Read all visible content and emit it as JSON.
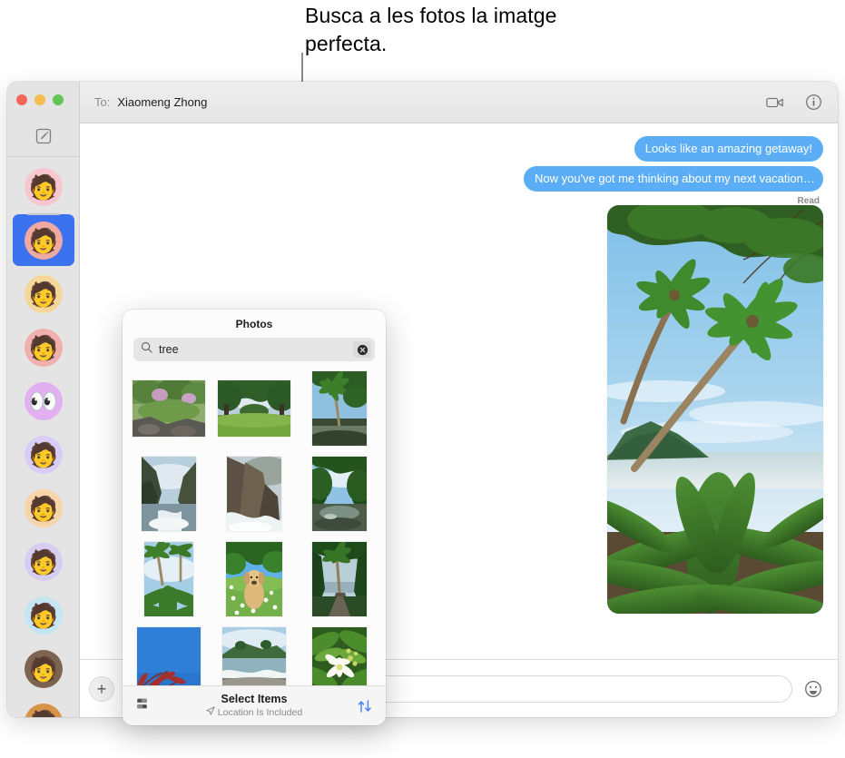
{
  "callout": {
    "text": "Busca a les fotos la imatge perfecta."
  },
  "window": {
    "titlebar": {
      "to_label": "To:",
      "recipient": "Xiaomeng Zhong",
      "facetime_icon": "video-camera-icon",
      "info_icon": "info-circle-icon"
    },
    "traffic_lights": {
      "close": "#f2655a",
      "minimize": "#f5bd4f",
      "zoom": "#61c454"
    }
  },
  "sidebar": {
    "compose_icon": "compose-new-message-icon",
    "selected_index": 1,
    "conversations": [
      {
        "name": "memoji-woman-headband",
        "bg": "#f7c7d0",
        "glyph": "👩",
        "selected": false
      },
      {
        "name": "memoji-woman-dark-hair",
        "bg": "#f0a9a0",
        "glyph": "👩",
        "selected": true
      },
      {
        "name": "memoji-person-green-cap",
        "bg": "#f6d79a",
        "glyph": "🧓",
        "selected": false
      },
      {
        "name": "memoji-woman-glasses-bun",
        "bg": "#f0b0ae",
        "glyph": "👩",
        "selected": false
      },
      {
        "name": "memoji-eyes-purple",
        "bg": "#e2aff0",
        "glyph": "👀",
        "selected": false
      },
      {
        "name": "memoji-man-yellow-glasses",
        "bg": "#d9cdf5",
        "glyph": "👨",
        "selected": false
      },
      {
        "name": "memoji-woman-grey-hair",
        "bg": "#f8d5a8",
        "glyph": "👵",
        "selected": false
      },
      {
        "name": "memoji-man-grey-hat",
        "bg": "#d5cdf2",
        "glyph": "🧔",
        "selected": false
      },
      {
        "name": "memoji-man-beard-beanie",
        "bg": "#c4e5f2",
        "glyph": "🧔",
        "selected": false
      },
      {
        "name": "photo-woman-smiling",
        "bg": "#7d6452",
        "glyph": "👩",
        "selected": false
      },
      {
        "name": "photo-person-partial",
        "bg": "#d79448",
        "glyph": "👤",
        "selected": false
      }
    ]
  },
  "thread": {
    "messages": [
      {
        "text": "Looks like an amazing getaway!",
        "side": "outgoing",
        "tail": false
      },
      {
        "text": "Now you've got me thinking about my next vacation…",
        "side": "outgoing",
        "tail": true
      }
    ],
    "read_receipt": "Read",
    "attached_photo": "tropical-beach-palm-trees-photo",
    "bubble_color": "#5baef5"
  },
  "compose": {
    "add_button_icon": "plus-icon",
    "input_value": "",
    "input_placeholder": "",
    "emoji_icon": "smiley-face-icon"
  },
  "photos_popover": {
    "title": "Photos",
    "search": {
      "icon": "magnifying-glass-icon",
      "value": "tree",
      "placeholder": "Search",
      "clear_icon": "clear-x-circle-icon"
    },
    "thumbnails": [
      {
        "name": "forest-stream-rocks-thumb",
        "orientation": "landscape"
      },
      {
        "name": "green-meadow-trees-thumb",
        "orientation": "landscape"
      },
      {
        "name": "palm-tree-river-thumb",
        "orientation": "portrait"
      },
      {
        "name": "coastal-cliffs-sea-thumb",
        "orientation": "portrait"
      },
      {
        "name": "rocky-shoreline-surf-thumb",
        "orientation": "portrait"
      },
      {
        "name": "jungle-river-reflection-thumb",
        "orientation": "portrait"
      },
      {
        "name": "palm-trees-foliage-thumb",
        "orientation": "portrait"
      },
      {
        "name": "dog-in-flower-field-thumb",
        "orientation": "portrait"
      },
      {
        "name": "palm-path-ocean-thumb",
        "orientation": "portrait"
      },
      {
        "name": "red-leaves-blue-sky-thumb",
        "orientation": "portrait"
      },
      {
        "name": "beach-shoreline-thumb",
        "orientation": "portrait"
      },
      {
        "name": "white-flower-leaves-thumb",
        "orientation": "portrait"
      }
    ],
    "footer": {
      "layout_icon": "layout-toggle-icon",
      "title": "Select Items",
      "subtitle": "Location Is Included",
      "location_icon": "location-arrow-icon",
      "sort_icon": "sort-arrows-icon",
      "sort_color": "#4a88f0"
    }
  }
}
